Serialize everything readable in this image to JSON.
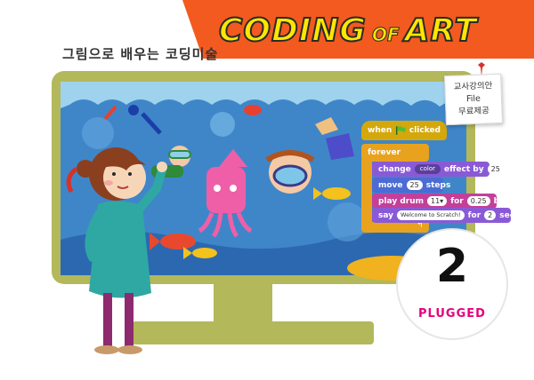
{
  "header": {
    "subtitle": "그림으로 배우는 코딩미술",
    "title_part1": "CODING",
    "title_part2": "OF",
    "title_part3": "ART"
  },
  "note": {
    "line1": "교사강의안",
    "line2": "File",
    "line3": "무료제공"
  },
  "code_blocks": {
    "when_label": "when",
    "clicked_label": "clicked",
    "forever_label": "forever",
    "change_label": "change",
    "color_label": "color",
    "effect_by_label": "effect by",
    "effect_value": "25",
    "move_label": "move",
    "move_value": "25",
    "steps_label": "steps",
    "play_drum_label": "play drum",
    "drum_value": "11▾",
    "for_label": "for",
    "beats_value": "0.25",
    "beats_label": "beats",
    "say_label": "say",
    "say_text": "Welcome to Scratch!",
    "for2_label": "for",
    "secs_value": "2",
    "secs_label": "secs"
  },
  "badge": {
    "number": "2",
    "label": "PLUGGED"
  },
  "colors": {
    "banner_orange": "#f25a1f",
    "monitor_green": "#b3b85a",
    "badge_magenta": "#e6007e",
    "events_yellow": "#d4a80a",
    "control_orange": "#e8a21e",
    "looks_purple": "#8a5ad6",
    "motion_blue": "#4a6cd4",
    "sound_magenta": "#c2409a"
  }
}
